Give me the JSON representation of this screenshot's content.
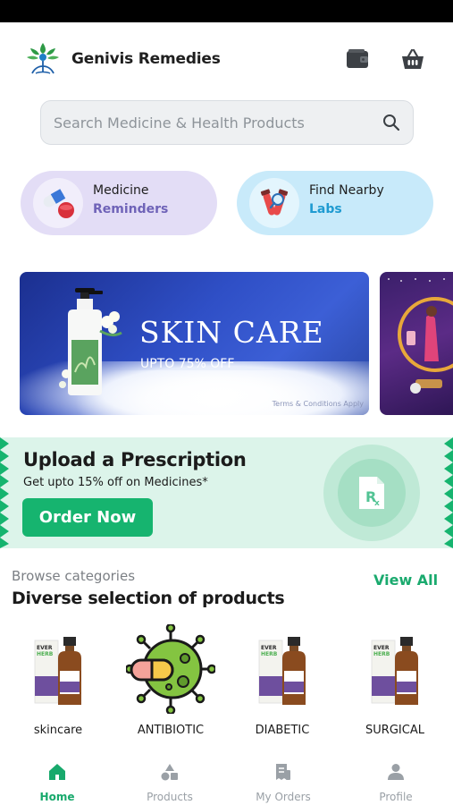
{
  "app": {
    "title": "Genivis Remedies"
  },
  "header": {
    "icons": [
      "wallet-icon",
      "basket-icon"
    ]
  },
  "search": {
    "placeholder": "Search Medicine & Health Products"
  },
  "quick_actions": [
    {
      "line1": "Medicine",
      "line2": "Reminders",
      "icon": "pills-icon",
      "accent": "#6f63b8"
    },
    {
      "line1": "Find Nearby",
      "line2": "Labs",
      "icon": "test-tubes-icon",
      "accent": "#1f9bd1"
    }
  ],
  "banner": {
    "title": "SKIN CARE",
    "subtitle": "UPTO 75% OFF",
    "terms": "Terms & Conditions Apply"
  },
  "prescription": {
    "title": "Upload a Prescription",
    "subtitle": "Get upto 15% off on Medicines*",
    "button": "Order Now",
    "accent": "#16b46f"
  },
  "categories_section": {
    "label": "Browse categories",
    "heading": "Diverse selection of products",
    "view_all": "View All",
    "items": [
      {
        "label": "skincare",
        "icon": "product-bottle-icon"
      },
      {
        "label": "ANTIBIOTIC",
        "icon": "virus-capsule-icon"
      },
      {
        "label": "DIABETIC",
        "icon": "product-bottle-icon"
      },
      {
        "label": "SURGICAL",
        "icon": "product-bottle-icon"
      }
    ]
  },
  "bottom_nav": [
    {
      "label": "Home",
      "icon": "home-icon",
      "active": true
    },
    {
      "label": "Products",
      "icon": "shapes-icon",
      "active": false
    },
    {
      "label": "My Orders",
      "icon": "orders-icon",
      "active": false
    },
    {
      "label": "Profile",
      "icon": "profile-icon",
      "active": false
    }
  ]
}
